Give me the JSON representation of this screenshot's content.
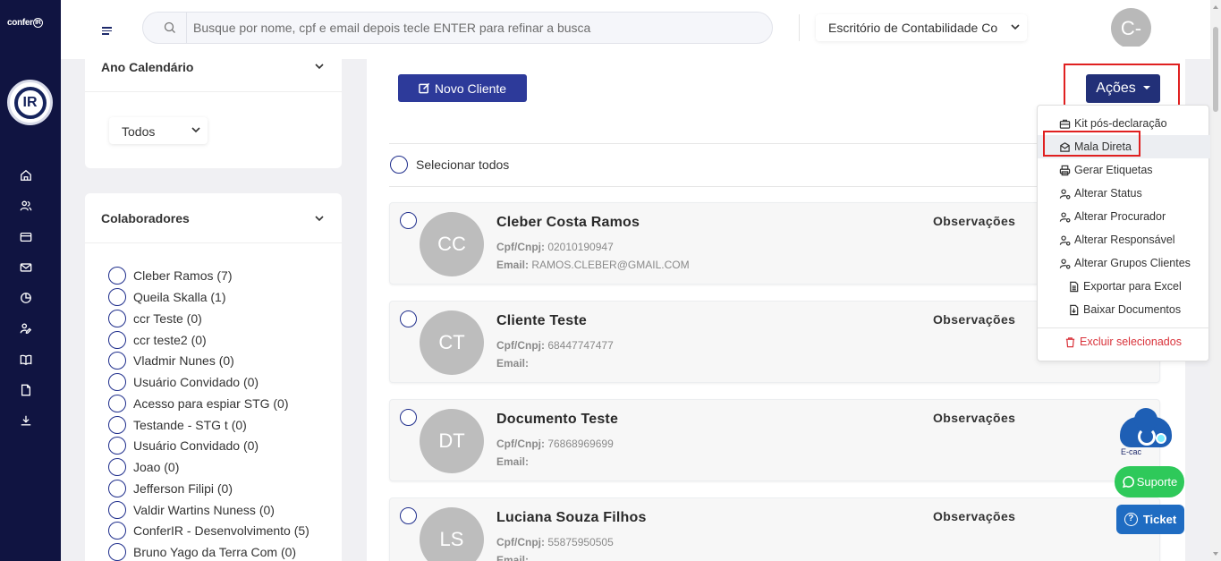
{
  "brand": {
    "name": "conferIR",
    "logo_text": "IR"
  },
  "nav": {
    "items": [
      {
        "name": "home-icon"
      },
      {
        "name": "users-icon"
      },
      {
        "name": "card-icon"
      },
      {
        "name": "mail-icon"
      },
      {
        "name": "pie-chart-icon"
      },
      {
        "name": "user-edit-icon"
      },
      {
        "name": "book-icon"
      },
      {
        "name": "document-icon"
      },
      {
        "name": "download-icon"
      }
    ]
  },
  "topbar": {
    "search_placeholder": "Busque por nome, cpf e email depois tecle ENTER para refinar a busca",
    "office": "Escritório de Contabilidade Co",
    "user_initials": "C-"
  },
  "filters": {
    "year_title": "Ano Calendário",
    "year_value": "Todos",
    "collab_title": "Colaboradores",
    "collaborators": [
      "Cleber Ramos (7)",
      "Queila Skalla (1)",
      "ccr Teste (0)",
      "ccr teste2 (0)",
      "Vladmir Nunes (0)",
      "Usuário Convidado (0)",
      "Acesso para espiar STG (0)",
      "Testande - STG t (0)",
      "Usuário Convidado (0)",
      "Joao (0)",
      "Jefferson Filipi (0)",
      "Valdir Wartins Nuness (0)",
      "ConferIR - Desenvolvimento (5)",
      "Bruno Yago da Terra Com (0)"
    ]
  },
  "main": {
    "new_client_label": "Novo Cliente",
    "select_all_label": "Selecionar todos",
    "cpf_label": "Cpf/Cnpj:",
    "email_label": "Email:",
    "obs_label": "Observações",
    "clients": [
      {
        "initials": "CC",
        "name": "Cleber Costa Ramos",
        "cpf": "02010190947",
        "email": "RAMOS.CLEBER@GMAIL.COM"
      },
      {
        "initials": "CT",
        "name": "Cliente Teste",
        "cpf": "68447747477",
        "email": ""
      },
      {
        "initials": "DT",
        "name": "Documento Teste",
        "cpf": "76868969699",
        "email": ""
      },
      {
        "initials": "LS",
        "name": "Luciana Souza Filhos",
        "cpf": "55875950505",
        "email": ""
      }
    ]
  },
  "actions": {
    "button_label": "Ações",
    "menu": [
      {
        "label": "Kit pós-declaração",
        "icon": "briefcase-icon"
      },
      {
        "label": "Mala Direta",
        "icon": "envelope-icon",
        "highlighted": true
      },
      {
        "label": "Gerar Etiquetas",
        "icon": "printer-icon"
      },
      {
        "label": "Alterar Status",
        "icon": "user-cog-icon"
      },
      {
        "label": "Alterar Procurador",
        "icon": "user-cog-icon"
      },
      {
        "label": "Alterar Responsável",
        "icon": "user-cog-icon"
      },
      {
        "label": "Alterar Grupos Clientes",
        "icon": "user-cog-icon"
      },
      {
        "label": "Exportar para Excel",
        "icon": "excel-icon"
      },
      {
        "label": "Baixar Documentos",
        "icon": "file-download-icon"
      },
      {
        "label": "Excluir selecionados",
        "icon": "trash-icon",
        "danger": true
      }
    ]
  },
  "floating": {
    "ecac_label": "E-cac",
    "support_label": "Suporte",
    "ticket_label": "Ticket"
  },
  "colors": {
    "nav_bg": "#101441",
    "primary": "#2d3a9a",
    "actions_bg": "#223078",
    "highlight": "#e02020",
    "support": "#2ec95a",
    "ticket": "#1f6cc2"
  }
}
